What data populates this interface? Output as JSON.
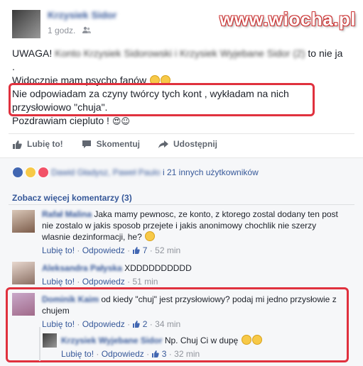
{
  "watermark": "www.wiocha.pl",
  "post": {
    "author": "Krzysiek Sidor",
    "time": "1 godz.",
    "line1_visible": "UWAGA!",
    "line1_blurred": "Konto Krzysiek Sidorowski i Krzysiek Wyjebane Sidor (2)",
    "line1_end": "to nie ja",
    "line2": ".",
    "line3": "Widocznie mam psycho fanów",
    "line4": "Nie odpowiadam za czyny twórcy tych kont , wykładam na nich",
    "line5": "przysłowiowo \"chuja\".",
    "line6": "Pozdrawiam ciepluto !",
    "line6_glyphs": "😍☺"
  },
  "actions": {
    "like": "Lubię to!",
    "comment": "Skomentuj",
    "share": "Udostępnij"
  },
  "reactions": {
    "names_blurred": "Dawid Gładysz, Paweł Paulo",
    "others": "i 21 innych użytkowników"
  },
  "more_comments": "Zobacz więcej komentarzy (3)",
  "comments": [
    {
      "name": "Rafał Malina",
      "text": "Jaka mamy pewnosc, ze konto, z ktorego zostal dodany ten post nie zostalo w jakis sposob przejete i jakis anonimowy chochlik nie szerzy wlasnie dezinformacji, he?",
      "like": "Lubię to!",
      "reply": "Odpowiedz",
      "likes": "7",
      "time": "52 min"
    },
    {
      "name": "Aleksandra Pałyska",
      "text": "XDDDDDDDDDD",
      "like": "Lubię to!",
      "reply": "Odpowiedz",
      "time": "51 min"
    },
    {
      "name": "Dominik Kaim",
      "text": "od kiedy \"chuj\" jest przysłowiowy? podaj mi jedno przysłowie z chujem",
      "like": "Lubię to!",
      "reply": "Odpowiedz",
      "likes": "2",
      "time": "34 min"
    },
    {
      "name": "Krzysiek Wyjebane Sidor",
      "text": "Np. Chuj Ci w dupę",
      "like": "Lubię to!",
      "reply": "Odpowiedz",
      "likes": "3",
      "time": "32 min"
    }
  ],
  "colors": {
    "link": "#365899",
    "highlight": "#e0313e",
    "meta": "#90949c"
  }
}
